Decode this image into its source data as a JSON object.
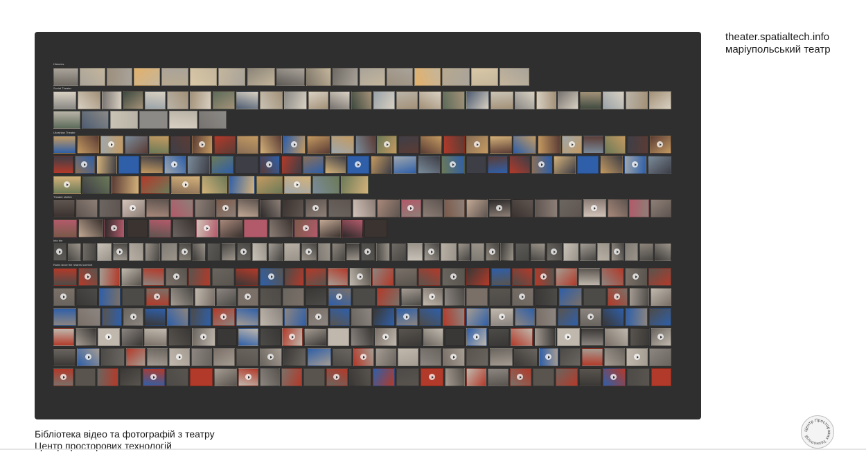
{
  "header": {
    "site": "theater.spatialtech.info",
    "subtitle": "маріупольський театр"
  },
  "footer": {
    "title": "Бібліотека відео та фотографій з театру",
    "org": "Центр просторових технологій"
  },
  "logo": {
    "text": "Центр Просторових Технологій",
    "icon": "circular-text-logo"
  },
  "library": {
    "sections": [
      {
        "label": "Historics",
        "rows": [
          {
            "count": 17
          }
        ]
      },
      {
        "label": "Soviet Theater",
        "rows": [
          {
            "count": 27
          },
          {
            "count": 6
          }
        ]
      },
      {
        "label": "Ukrainian Theater",
        "rows": [
          {
            "count": 27
          },
          {
            "count": 27
          },
          {
            "count": 11
          }
        ]
      },
      {
        "label": "Theater shelter",
        "rows": [
          {
            "count": 27
          },
          {
            "count": 14
          }
        ]
      },
      {
        "label": "Into the",
        "rows": [
          {
            "count": 40
          }
        ]
      },
      {
        "label": "Ruins since the nearest comfort",
        "rows": [
          {
            "count": 27
          },
          {
            "count": 27
          },
          {
            "count": 27
          },
          {
            "count": 27
          },
          {
            "count": 27
          },
          {
            "count": 27
          }
        ]
      }
    ]
  },
  "colors": {
    "panel": "#2f2f2f",
    "page": "#ffffff",
    "accent_red": "#b23a2a",
    "accent_blue": "#2f5fa8"
  }
}
